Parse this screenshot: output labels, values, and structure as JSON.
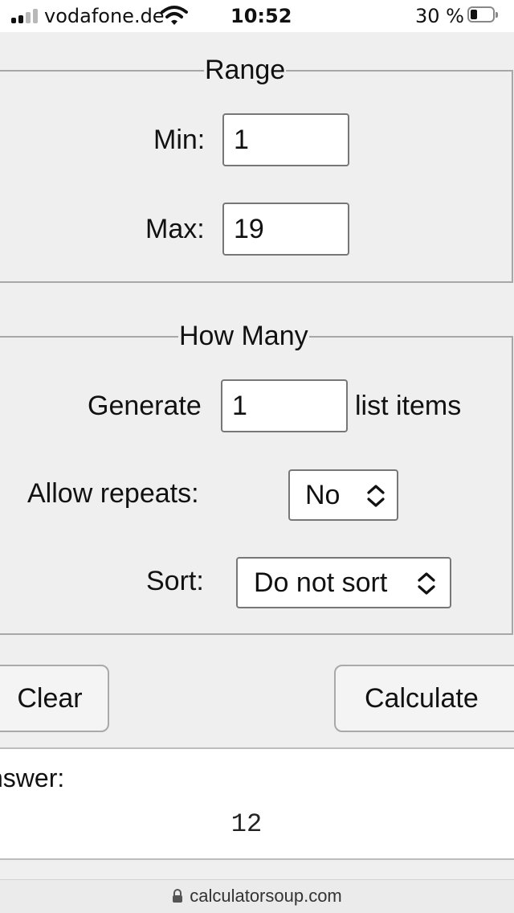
{
  "status_bar": {
    "carrier": "vodafone.de",
    "time": "10:52",
    "battery_percent": "30 %",
    "battery_level": 0.3,
    "signal_bars_active": 2,
    "signal_bars_total": 4,
    "icons": [
      "signal-icon",
      "wifi-icon",
      "battery-icon"
    ]
  },
  "range": {
    "legend": "Range",
    "min_label": "Min:",
    "min_value": "1",
    "max_label": "Max:",
    "max_value": "19"
  },
  "how_many": {
    "legend": "How Many",
    "generate_label": "Generate",
    "generate_value": "1",
    "list_items_label": "list items",
    "repeats_label": "Allow repeats:",
    "repeats_value": "No",
    "sort_label": "Sort:",
    "sort_value": "Do not sort"
  },
  "buttons": {
    "clear": "Clear",
    "calculate": "Calculate"
  },
  "answer": {
    "label": "nswer:",
    "value": "12"
  },
  "url_bar": {
    "domain": "calculatorsoup.com"
  }
}
